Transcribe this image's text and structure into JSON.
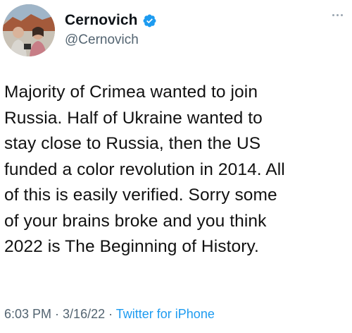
{
  "tweet": {
    "author": {
      "display_name": "Cernovich",
      "handle": "@Cernovich",
      "verified": true,
      "verified_icon": "verified-badge-icon",
      "avatar": "profile-photo"
    },
    "more_icon": "more-horizontal-icon",
    "text_lines": [
      "Majority of Crimea wanted to join",
      "Russia. Half of Ukraine wanted to",
      "stay close to Russia, then the US",
      "funded a color revolution in 2014. All",
      "of this is easily verified. Sorry some",
      "of your brains broke and you think",
      "2022 is The Beginning of History."
    ],
    "meta": {
      "time": "6:03 PM",
      "separator": " · ",
      "date": "3/16/22",
      "source": "Twitter for iPhone"
    }
  },
  "colors": {
    "text": "#0f1419",
    "secondary": "#536471",
    "link": "#1d9bf0",
    "verified": "#1d9bf0"
  }
}
